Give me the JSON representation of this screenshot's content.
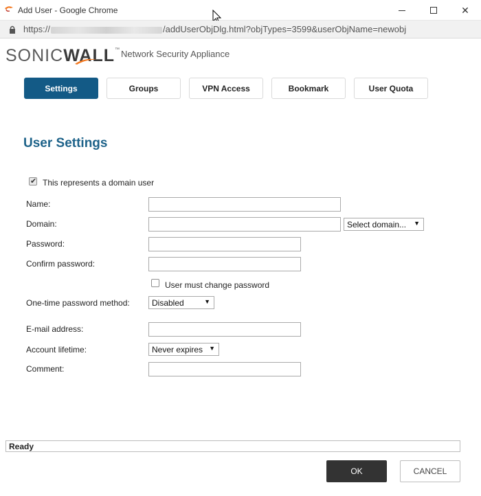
{
  "window": {
    "title": "Add User - Google Chrome"
  },
  "address": {
    "scheme": "https://",
    "path": "/addUserObjDlg.html?objTypes=3599&userObjName=newobj"
  },
  "brand": {
    "logo_plain": "SONIC",
    "logo_bold": "WALL",
    "tm": "™",
    "subtitle": "Network Security Appliance",
    "accent": "#f47920"
  },
  "tabs": [
    {
      "label": "Settings",
      "active": true
    },
    {
      "label": "Groups"
    },
    {
      "label": "VPN Access"
    },
    {
      "label": "Bookmark"
    },
    {
      "label": "User Quota"
    }
  ],
  "section": {
    "title": "User Settings"
  },
  "form": {
    "domain_user": {
      "label": "This represents a domain user",
      "checked": true
    },
    "name": {
      "label": "Name:",
      "value": ""
    },
    "domain": {
      "label": "Domain:",
      "value": "",
      "select": "Select domain..."
    },
    "password": {
      "label": "Password:",
      "value": ""
    },
    "confirm": {
      "label": "Confirm password:",
      "value": ""
    },
    "must_change": {
      "label": "User must change password",
      "checked": false
    },
    "otp": {
      "label": "One-time password method:",
      "value": "Disabled"
    },
    "email": {
      "label": "E-mail address:",
      "value": ""
    },
    "lifetime": {
      "label": "Account lifetime:",
      "value": "Never expires"
    },
    "comment": {
      "label": "Comment:",
      "value": ""
    }
  },
  "status": {
    "text": "Ready"
  },
  "buttons": {
    "ok": "OK",
    "cancel": "CANCEL"
  },
  "colors": {
    "primary": "#135a86",
    "title": "#1d6289",
    "ok_bg": "#333333"
  }
}
